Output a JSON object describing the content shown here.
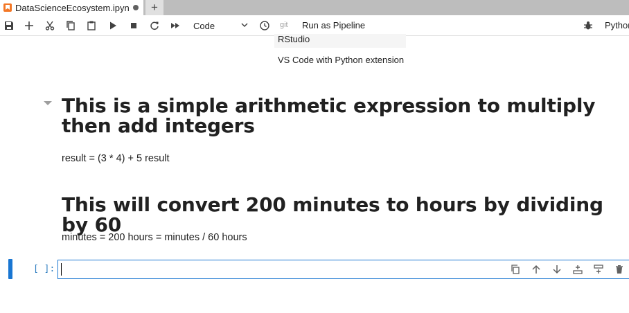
{
  "tab": {
    "title": "DataScienceEcosystem.ipyn"
  },
  "toolbar": {
    "cell_type": "Code",
    "git_label": "git",
    "pipeline_label": "Run as Pipeline",
    "kernel_name": "Python"
  },
  "overlay_list": {
    "items": [
      "RStudio",
      "VS Code with Python extension"
    ]
  },
  "cells": {
    "heading1": "This is a simple arithmetic expression to multiply then add integers",
    "text1": "result = (3 * 4) + 5 result",
    "heading2": "This will convert 200 minutes to hours by dividing by 60",
    "text2": "minutes = 200 hours = minutes / 60 hours",
    "code_prompt": "[ ]:"
  },
  "colors": {
    "accent": "#1976d2",
    "tab_icon": "#f37726",
    "prompt": "#307fc1"
  }
}
